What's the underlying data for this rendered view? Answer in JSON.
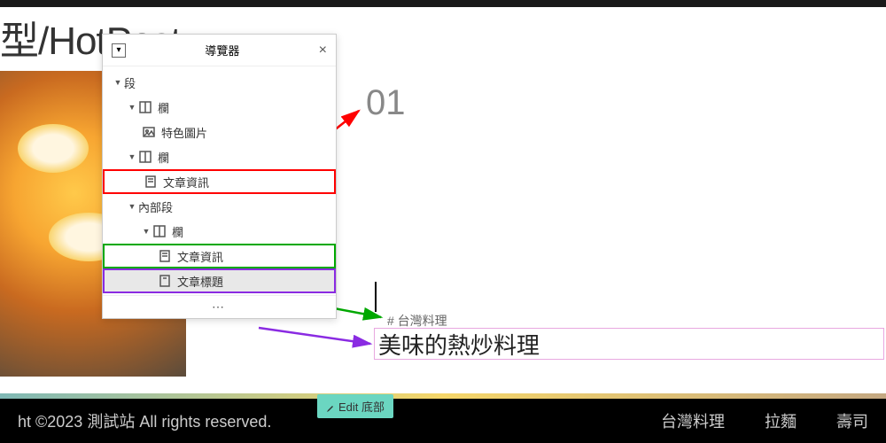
{
  "header": {
    "breadcrumb_tail": "型/HotPost"
  },
  "navigator": {
    "title": "導覽器",
    "items": {
      "section": "段",
      "col1": "欄",
      "featured_img": "特色圖片",
      "col2": "欄",
      "post_info1": "文章資訊",
      "inner_section": "內部段",
      "col3": "欄",
      "post_info2": "文章資訊",
      "post_title": "文章標題"
    },
    "footer_dots": "⋯"
  },
  "content": {
    "number": "01",
    "hashtag": "# 台灣料理",
    "post_title": "美味的熱炒料理"
  },
  "edit_button": "Edit 底部",
  "footer": {
    "copyright": "ht ©2023 測試站 All rights reserved.",
    "links": {
      "tw": "台灣料理",
      "ramen": "拉麵",
      "sushi": "壽司"
    }
  }
}
